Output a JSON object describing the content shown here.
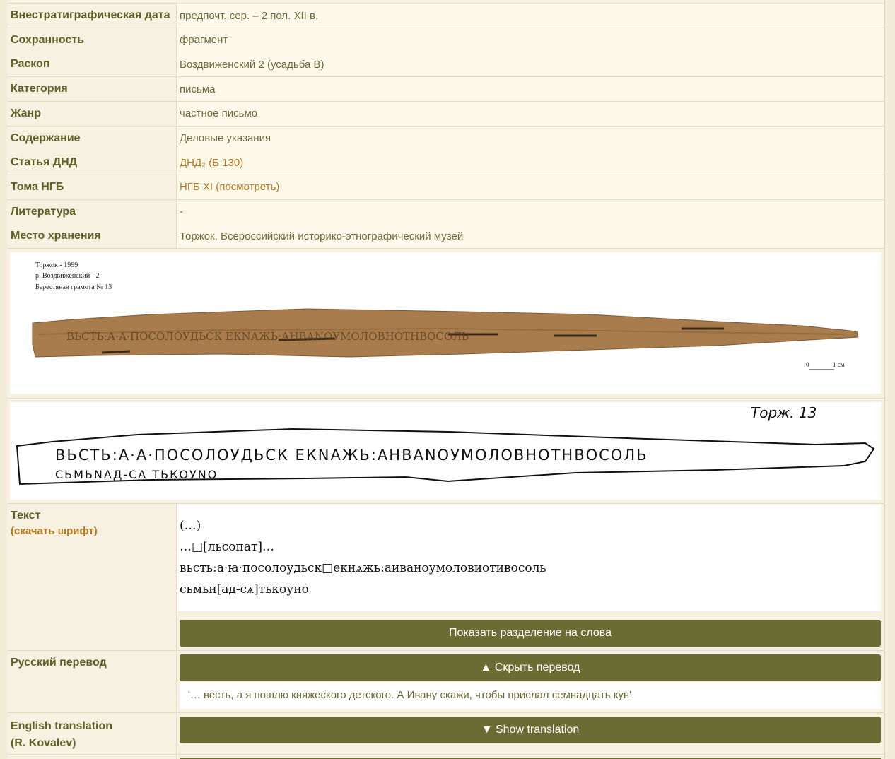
{
  "meta_rows": [
    {
      "label": "Внестратиграфическая дата",
      "value": "предпочт. сер. – 2 пол. XII в."
    },
    {
      "label": "Сохранность",
      "value": "фрагмент"
    },
    {
      "label": "Раскоп",
      "value": "Воздвиженский 2 (усадьба В)"
    },
    {
      "label": "Категория",
      "value": "письма"
    },
    {
      "label": "Жанр",
      "value": "частное письмо"
    },
    {
      "label": "Содержание",
      "value": "Деловые указания"
    },
    {
      "label": "Статья ДНД",
      "value_link": "ДНД₂",
      "value_rest_prefix": " (",
      "value_link2": "Б 130",
      "value_rest_suffix": ")"
    },
    {
      "label": "Тома НГБ",
      "value_link": "НГБ XI",
      "value_rest_prefix": " (",
      "value_link2": "посмотреть",
      "value_rest_suffix": ")"
    },
    {
      "label": "Литература",
      "value": "-"
    },
    {
      "label": "Место хранения",
      "value": "Торжок, Всероссийский историко-этнографический музей"
    }
  ],
  "photo": {
    "caption_lines": [
      "Торжок - 1999",
      "р. Воздвиженский - 2",
      "Берестяная грамота № 13"
    ],
    "scale": {
      "zero": "0",
      "one": "1 см"
    }
  },
  "drawing": {
    "title": "Торж. 13",
    "line1": "ВЬСТЬ:А·А·ПОСОЛОУДЬСК ЕКNАЖЬ:АНВАNОУМОЛОВНОТНВОСОЛЬ",
    "line2": "СЬМЬNАД-СА ТЬКОУNО"
  },
  "text_section": {
    "label": "Текст",
    "download_font": "(скачать шрифт)",
    "lines": [
      "(…)",
      "…□[льсопaт]…",
      "вьсть:a·ꙗ·посолоудьск□екнѧжь:аиваноумоловиотивосоль",
      "сьмьн[ад-сѧ]тькоуно"
    ],
    "button": "Показать разделение на слова"
  },
  "russian": {
    "label": "Русский перевод",
    "button": "▲ Скрыть перевод",
    "text": "'… весть, а я пошлю княжеского детского. А Ивану скажи, чтобы прислал семнадцать кун'."
  },
  "english": {
    "label_line1": "English translation",
    "label_line2": "(R. Kovalev)",
    "button": "▼ Show translation"
  },
  "colors": {
    "button": "#6b6b34",
    "label": "#5f5f26",
    "link": "#b9791d",
    "bark": "#a97c4d"
  }
}
